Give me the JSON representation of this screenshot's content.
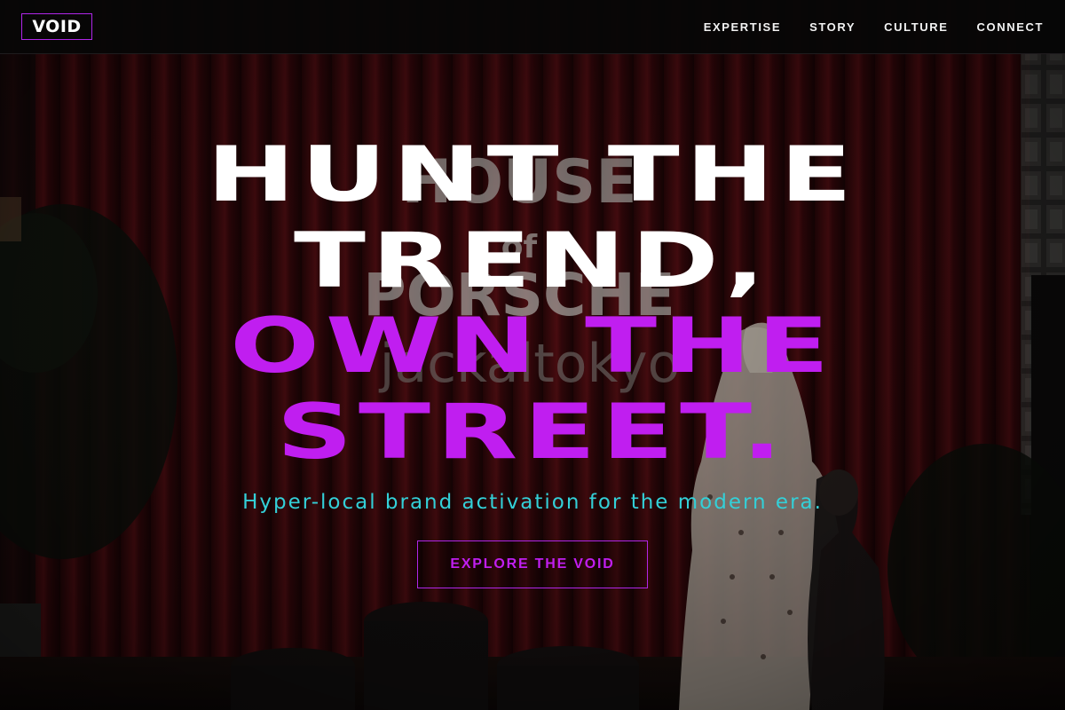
{
  "brand": {
    "logo_text": "VOID",
    "accent": "#b026e8"
  },
  "nav": {
    "items": [
      {
        "label": "EXPERTISE"
      },
      {
        "label": "STORY"
      },
      {
        "label": "CULTURE"
      },
      {
        "label": "CONNECT"
      }
    ]
  },
  "hero": {
    "headline_lines": [
      "HUNT THE",
      "TREND,",
      "OWN THE",
      "STREET."
    ],
    "headline_colors": {
      "white": "#ffffff",
      "purple": "#c01ef0"
    },
    "subtitle": "Hyper-local brand activation for the modern era.",
    "subtitle_color": "#33d0d8",
    "cta_label": "EXPLORE THE VOID"
  },
  "background": {
    "signage_lines": [
      "HOUSE",
      "of",
      "PORSCHE",
      "jackaltokyo"
    ]
  }
}
